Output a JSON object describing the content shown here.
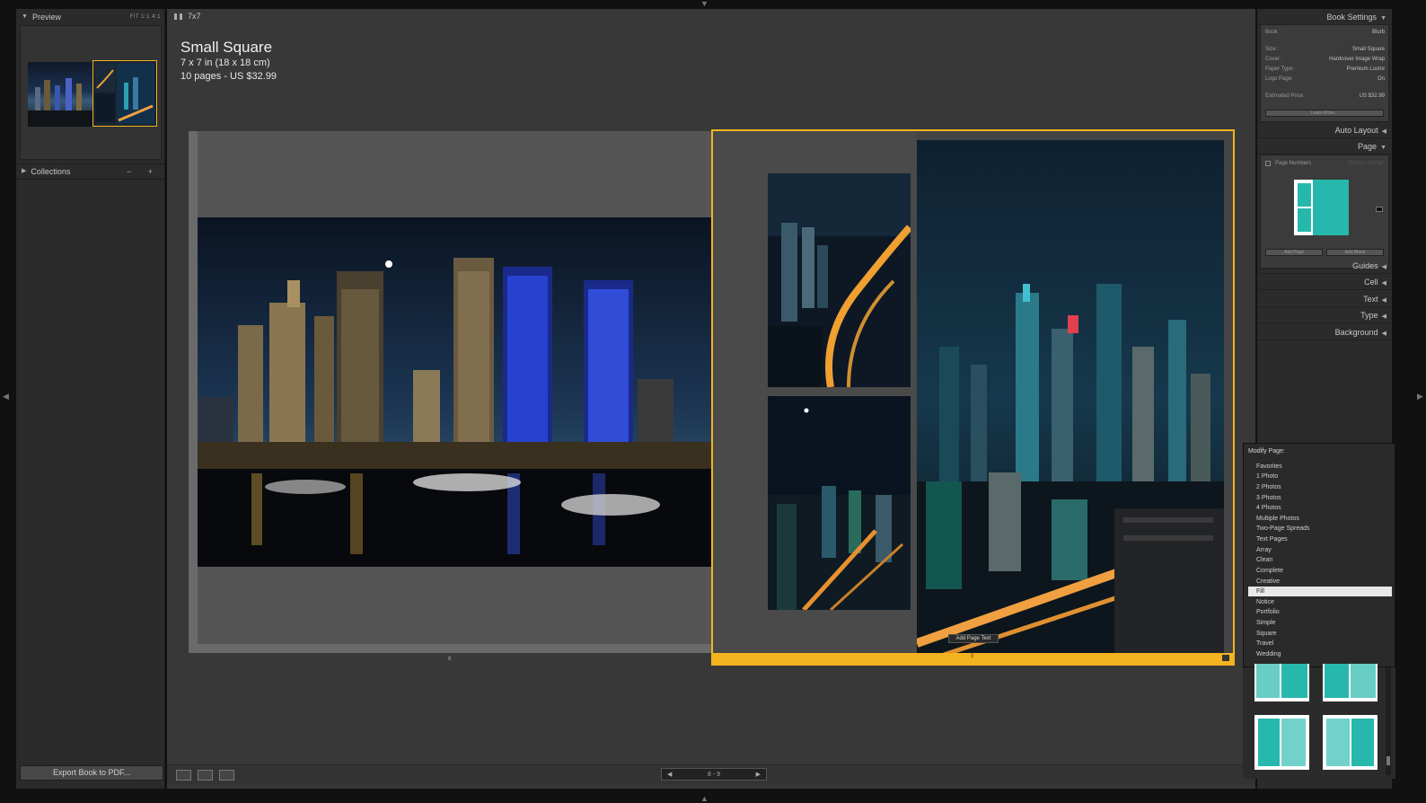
{
  "left_panel": {
    "preview": {
      "label": "Preview",
      "zoom_options": "FIT  1:1  4:1"
    },
    "collections": {
      "label": "Collections",
      "controls": "− +"
    },
    "export_button": "Export Book to PDF..."
  },
  "center": {
    "toolbar_label": "7x7",
    "book": {
      "title": "Small Square",
      "dimensions": "7 x 7 in (18 x 18 cm)",
      "pages_price": "10 pages - US $32.99"
    },
    "left_page_number": "8",
    "right_page_number": "9",
    "add_page_text": "Add Page Text",
    "nav": {
      "prev": "◀",
      "range": "8 - 9",
      "next": "▶"
    }
  },
  "right_panel": {
    "book_settings": {
      "title": "Book Settings",
      "book": {
        "label": "Book :",
        "value": "Blurb"
      },
      "size": {
        "label": "Size :",
        "value": "Small Square"
      },
      "cover": {
        "label": "Cover :",
        "value": "Hardcover Image Wrap"
      },
      "paper": {
        "label": "Paper Type:",
        "value": "Premium Lustre"
      },
      "logo": {
        "label": "Logo Page:",
        "value": "On"
      },
      "price": {
        "label": "Estimated Price:",
        "value": "US $32.99"
      },
      "learn_more": "Learn More..."
    },
    "auto_layout": "Auto Layout",
    "page": {
      "title": "Page",
      "page_numbers": {
        "label": "Page Numbers",
        "value": "Bottom Corner"
      },
      "add_page": "Add Page",
      "add_blank": "Add Blank"
    },
    "sections": [
      "Guides",
      "Cell",
      "Text",
      "Type",
      "Background"
    ]
  },
  "menu": {
    "title": "Modify Page:",
    "items": [
      "Favorites",
      "1 Photo",
      "2 Photos",
      "3 Photos",
      "4 Photos",
      "Multiple Photos",
      "Two-Page Spreads",
      "Text Pages",
      "Array",
      "Clean",
      "Complete",
      "Creative",
      "Fill",
      "Notice",
      "Portfolio",
      "Simple",
      "Square",
      "Travel",
      "Wedding"
    ],
    "selected": "Fill"
  },
  "colors": {
    "accent": "#f3b41f",
    "teal": "#27b8ad",
    "panel": "#2b2b2b",
    "canvas": "#383838"
  }
}
